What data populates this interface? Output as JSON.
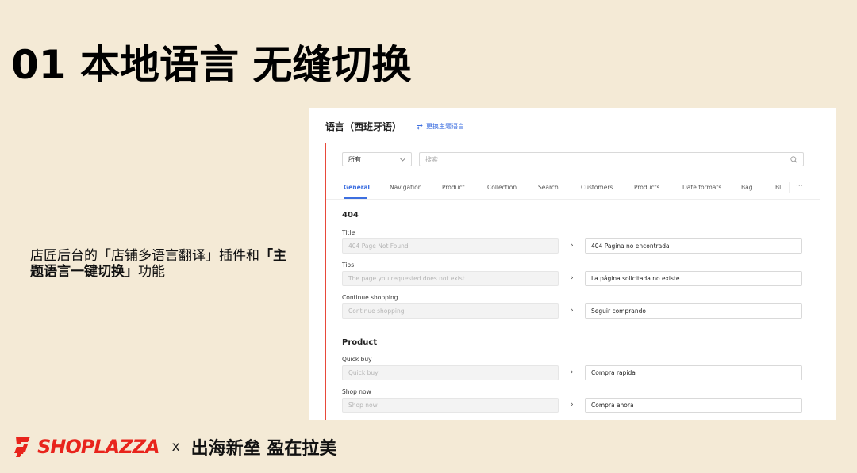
{
  "slide": {
    "title": "01 本地语言 无缝切换",
    "desc_part1": "店匠后台的「店铺多语言翻译」插件和",
    "desc_bold": "「主题语言一键切换」",
    "desc_part2": "功能"
  },
  "screenshot": {
    "page_title": "语言（西班牙语）",
    "switch_link": "更换主题语言",
    "filter": {
      "select_value": "所有",
      "search_placeholder": "搜索"
    },
    "tabs": [
      "General",
      "Navigation",
      "Product",
      "Collection",
      "Search",
      "Customers",
      "Products",
      "Date formats",
      "Bag",
      "Bl"
    ],
    "active_tab": "General",
    "more_label": "···",
    "sections": [
      {
        "title": "404",
        "fields": [
          {
            "label": "Title",
            "source": "404 Page Not Found",
            "target": "404 Pagina no encontrada"
          },
          {
            "label": "Tips",
            "source": "The page you requested does not exist.",
            "target": "La página solicitada no existe."
          },
          {
            "label": "Continue shopping",
            "source": "Continue shopping",
            "target": "Seguir comprando"
          }
        ]
      },
      {
        "title": "Product",
        "fields": [
          {
            "label": "Quick buy",
            "source": "Quick buy",
            "target": "Compra rapida"
          },
          {
            "label": "Shop now",
            "source": "Shop now",
            "target": "Compra ahora"
          }
        ]
      }
    ]
  },
  "footer": {
    "brand": "SHOPLAZZA",
    "times": "x",
    "slogan": "出海新垒 盈在拉美"
  },
  "icons": {
    "switch": "swap-arrows-icon",
    "select": "chevron-down-icon",
    "search": "search-icon",
    "arrow": "chevron-right-icon",
    "logo": "shoplazza-logo-icon"
  },
  "colors": {
    "background": "#f4ead6",
    "accent_blue": "#3d6fe0",
    "highlight_red": "#e8493a",
    "brand_red": "#e8241c"
  }
}
